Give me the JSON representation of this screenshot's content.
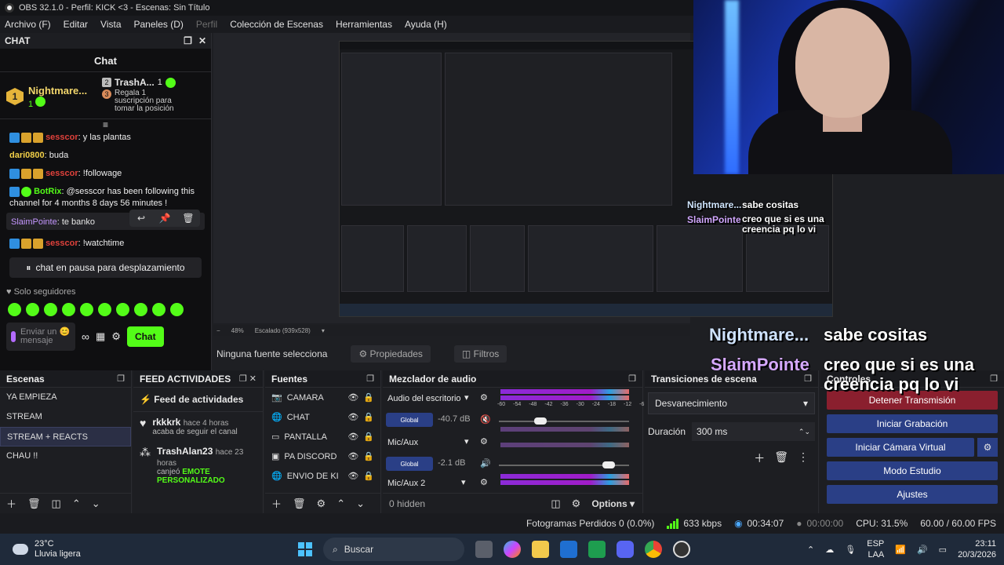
{
  "titlebar": {
    "title": "OBS 32.1.0 - Perfil: KICK <3 - Escenas: Sin Título"
  },
  "menu": [
    "Archivo (F)",
    "Editar",
    "Vista",
    "Paneles (D)",
    "Perfil",
    "Colección de Escenas",
    "Herramientas",
    "Ayuda (H)"
  ],
  "chat_dock": {
    "header": "CHAT",
    "title": "Chat",
    "leader1": {
      "rank": "1",
      "name": "Nightmare...",
      "count": "1"
    },
    "leader2": {
      "rank": "2",
      "name": "TrashA...",
      "count": "1"
    },
    "leader3": {
      "rank": "3",
      "text": "Regala 1 suscripción para tomar la posición 3"
    },
    "messages": [
      {
        "user": "sesscor",
        "text": ": y las plantas"
      },
      {
        "user": "dari0800",
        "text": ": buda"
      },
      {
        "user": "sesscor",
        "text": ": !followage"
      },
      {
        "user": "BotRix",
        "text": ": @sesscor has been following this channel for 4 months 8 days 56 minutes !"
      },
      {
        "user": "SlaimPointe",
        "text": ": te banko"
      },
      {
        "user": "sesscor",
        "text": ": !watchtime"
      }
    ],
    "pause_text": "chat en pausa para desplazamiento",
    "followers_only": "Solo seguidores",
    "input_placeholder": "Enviar un 😊 mensaje",
    "chat_button": "Chat"
  },
  "overlay": {
    "small1_user": "Nightmare...",
    "small1_msg": "sabe cositas",
    "small2_user": "SlaimPointe",
    "small2_msg": "creo que si es una creencia pq lo vi",
    "big1_user": "Nightmare...",
    "big1_msg": "sabe cositas",
    "big2_user": "SlaimPointe",
    "big2_msg": "creo que si es una creencia pq lo vi"
  },
  "preview_bar": {
    "zoom": "48%",
    "scale": "Escalado (939x528)"
  },
  "source_bar": {
    "no_source": "Ninguna fuente selecciona",
    "properties": "Propiedades",
    "filters": "Filtros"
  },
  "scenes": {
    "header": "Escenas",
    "items": [
      "YA EMPIEZA",
      "STREAM",
      "STREAM + REACTS",
      "CHAU !!"
    ],
    "selected": 2
  },
  "feed": {
    "header": "FEED ACTIVIDADES",
    "title": "Feed de actividades",
    "items": [
      {
        "name": "rkkkrk",
        "time": "hace 4 horas",
        "desc": "acaba de seguir el canal"
      },
      {
        "name": "TrashAlan23",
        "time": "hace 23 horas",
        "desc": "canjeó",
        "emphasis": "EMOTE PERSONALIZADO"
      }
    ]
  },
  "sources": {
    "header": "Fuentes",
    "items": [
      "CAMARA",
      "CHAT",
      "PANTALLA",
      "PA DISCORD",
      "ENVIO DE KI"
    ]
  },
  "mixer": {
    "header": "Mezclador de audio",
    "tracks": [
      {
        "name": "Audio del escritorio",
        "db": "-40.7 dB",
        "level": 0.3
      },
      {
        "name": "Mic/Aux",
        "db": "-2.1 dB",
        "level": 0.88
      },
      {
        "name": "Mic/Aux 2"
      }
    ],
    "global_label": "Global",
    "ticks": [
      "-60",
      "-54",
      "-48",
      "-42",
      "-36",
      "-30",
      "-24",
      "-18",
      "-12",
      "-6",
      "0"
    ],
    "hidden": "0 hidden",
    "options": "Options"
  },
  "transitions": {
    "header": "Transiciones de escena",
    "type": "Desvanecimiento",
    "duration_label": "Duración",
    "duration": "300 ms"
  },
  "controls": {
    "header": "Controles",
    "stop_stream": "Detener Transmisión",
    "record": "Iniciar Grabación",
    "virtual_cam": "Iniciar Cámara Virtual",
    "studio": "Modo Estudio",
    "settings": "Ajustes"
  },
  "status": {
    "dropped": "Fotogramas Perdidos 0 (0.0%)",
    "kbps": "633 kbps",
    "stream_time": "00:34:07",
    "rec_time": "00:00:00",
    "cpu": "CPU: 31.5%",
    "fps": "60.00 / 60.00 FPS"
  },
  "taskbar": {
    "temp": "23°C",
    "weather": "Lluvia ligera",
    "search": "Buscar",
    "lang1": "ESP",
    "lang2": "LAA",
    "time": "23:11",
    "date": "20/3/2026"
  }
}
